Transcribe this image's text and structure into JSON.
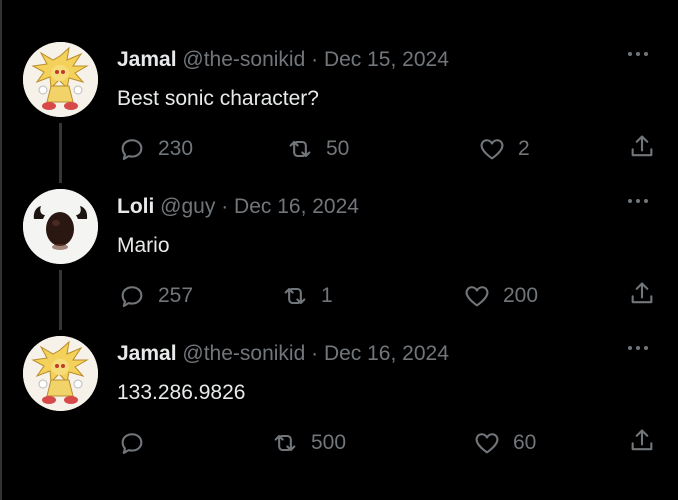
{
  "tweets": [
    {
      "name": "Jamal",
      "handle": "@the-sonikid",
      "separator": "·",
      "date": "Dec 15, 2024",
      "text": "Best sonic character?",
      "replies": "230",
      "retweets": "50",
      "likes": "2",
      "avatar_icon": "super-sonic-avatar"
    },
    {
      "name": "Loli",
      "handle": "@guy",
      "separator": "·",
      "date": "Dec 16, 2024",
      "text": "Mario",
      "replies": "257",
      "retweets": "1",
      "likes": "200",
      "avatar_icon": "mustache-avatar"
    },
    {
      "name": "Jamal",
      "handle": "@the-sonikid",
      "separator": "·",
      "date": "Dec 16, 2024",
      "text": "133.286.9826",
      "replies": "",
      "retweets": "500",
      "likes": "60",
      "avatar_icon": "super-sonic-avatar"
    }
  ],
  "colors": {
    "background": "#000000",
    "text_primary": "#e7e9ea",
    "text_secondary": "#71767b",
    "thread_line": "#333639"
  }
}
